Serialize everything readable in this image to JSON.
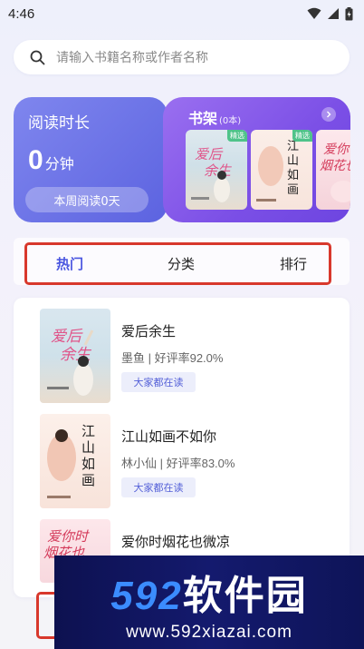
{
  "status_bar": {
    "time": "4:46"
  },
  "search": {
    "placeholder": "请输入书籍名称或作者名称"
  },
  "reading_card": {
    "title": "阅读时长",
    "value": "0",
    "unit": "分钟",
    "weekly_button": "本周阅读0天"
  },
  "bookshelf": {
    "title": "书架",
    "count": "(0本)",
    "books": [
      {
        "cover_text": "爱后余生",
        "badge": "精选"
      },
      {
        "cover_text": "江山如画",
        "badge": "精选"
      },
      {
        "cover_text": "爱你时烟花也",
        "badge": ""
      }
    ]
  },
  "tabs": [
    {
      "label": "热门",
      "active": true
    },
    {
      "label": "分类",
      "active": false
    },
    {
      "label": "排行",
      "active": false
    }
  ],
  "books": [
    {
      "title": "爱后余生",
      "meta": "墨鱼 | 好评率92.0%",
      "tag": "大家都在读",
      "cover_text": "爱后余生"
    },
    {
      "title": "江山如画不如你",
      "meta": "林小仙 | 好评率83.0%",
      "tag": "大家都在读",
      "cover_text": "江山如画"
    },
    {
      "title": "爱你时烟花也微凉",
      "meta": "",
      "tag": "",
      "cover_text": "爱你时烟花也微凉"
    }
  ],
  "watermark": {
    "main_prefix": "592",
    "main_suffix": "软件园",
    "url": "www.592xiazai.com"
  },
  "colors": {
    "accent": "#4a56e0",
    "highlight": "#d8382c",
    "reading_card": "#6a71e6",
    "shelf_card": "#8a5ff0"
  }
}
